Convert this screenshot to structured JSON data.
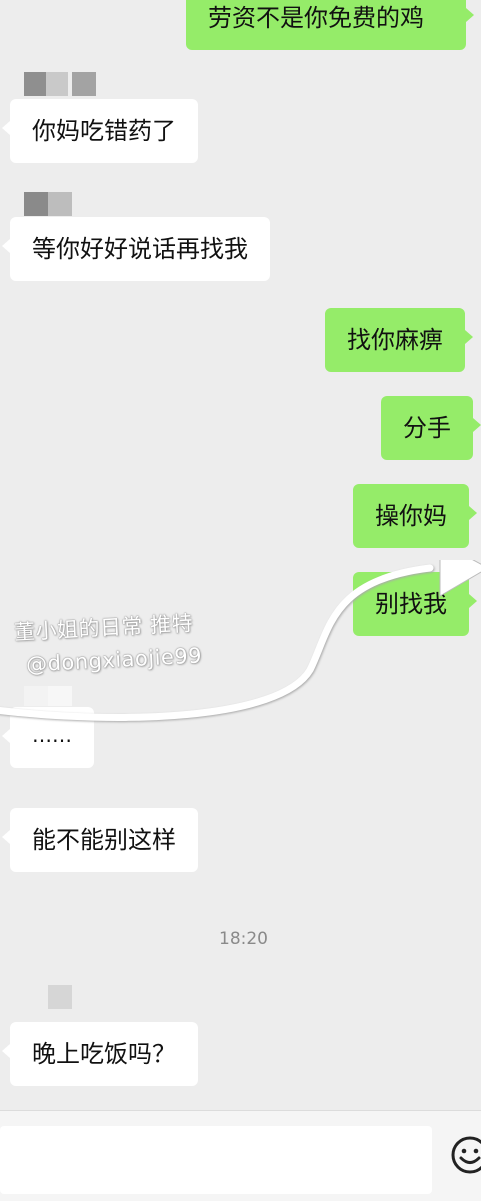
{
  "messages": [
    {
      "side": "out",
      "text": "劳资不是你免费的鸡"
    },
    {
      "side": "in",
      "text": "你妈吃错药了"
    },
    {
      "side": "in",
      "text": "等你好好说话再找我"
    },
    {
      "side": "out",
      "text": "找你麻痹"
    },
    {
      "side": "out",
      "text": "分手"
    },
    {
      "side": "out",
      "text": "操你妈"
    },
    {
      "side": "out",
      "text": "别找我"
    },
    {
      "side": "in",
      "text": "……"
    },
    {
      "side": "in",
      "text": "能不能别这样"
    },
    {
      "side": "in",
      "text": "晚上吃饭吗？"
    }
  ],
  "timestamp": "18:20",
  "watermark": {
    "line1": "董小姐的日常 推特",
    "line2": "@dongxiaojie99"
  },
  "input": {
    "value": "",
    "placeholder": ""
  },
  "colors": {
    "background": "#ededed",
    "outgoing_bubble": "#95ec69",
    "incoming_bubble": "#ffffff",
    "timestamp": "#8a8a8a"
  },
  "icons": {
    "emoji": "smiley-face-icon",
    "avatar": "pixelated-avatar"
  }
}
